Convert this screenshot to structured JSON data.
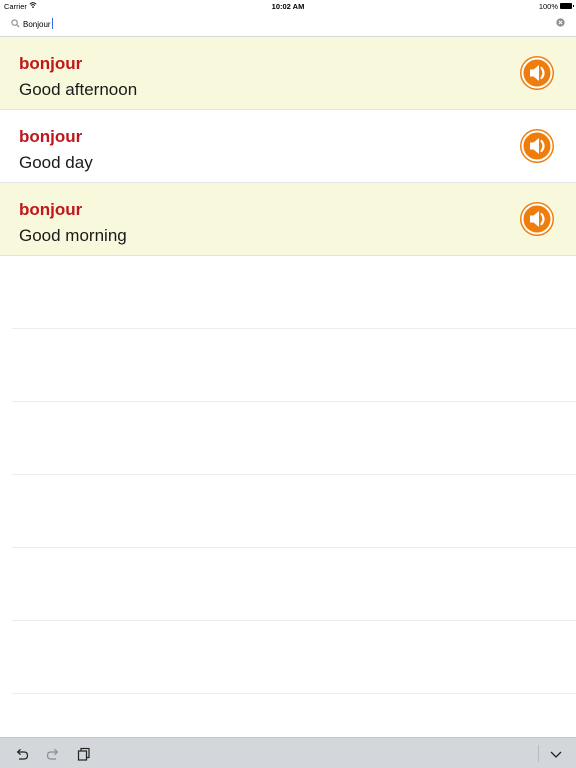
{
  "status_bar": {
    "carrier": "Carrier",
    "time": "10:02 AM",
    "battery": "100%"
  },
  "search": {
    "value": "Bonjour"
  },
  "results": [
    {
      "word": "bonjour",
      "meaning": "Good afternoon"
    },
    {
      "word": "bonjour",
      "meaning": "Good day"
    },
    {
      "word": "bonjour",
      "meaning": "Good morning"
    }
  ],
  "colors": {
    "accent_orange": "#ef7d0c",
    "word_red": "#c0171b",
    "row_highlight": "#f8f8dc"
  },
  "icons": {
    "search": "search-icon",
    "clear": "clear-icon",
    "speaker": "speaker-icon",
    "undo": "undo-icon",
    "redo": "redo-icon",
    "paste": "paste-icon",
    "dismiss_keyboard": "chevron-down-icon"
  }
}
